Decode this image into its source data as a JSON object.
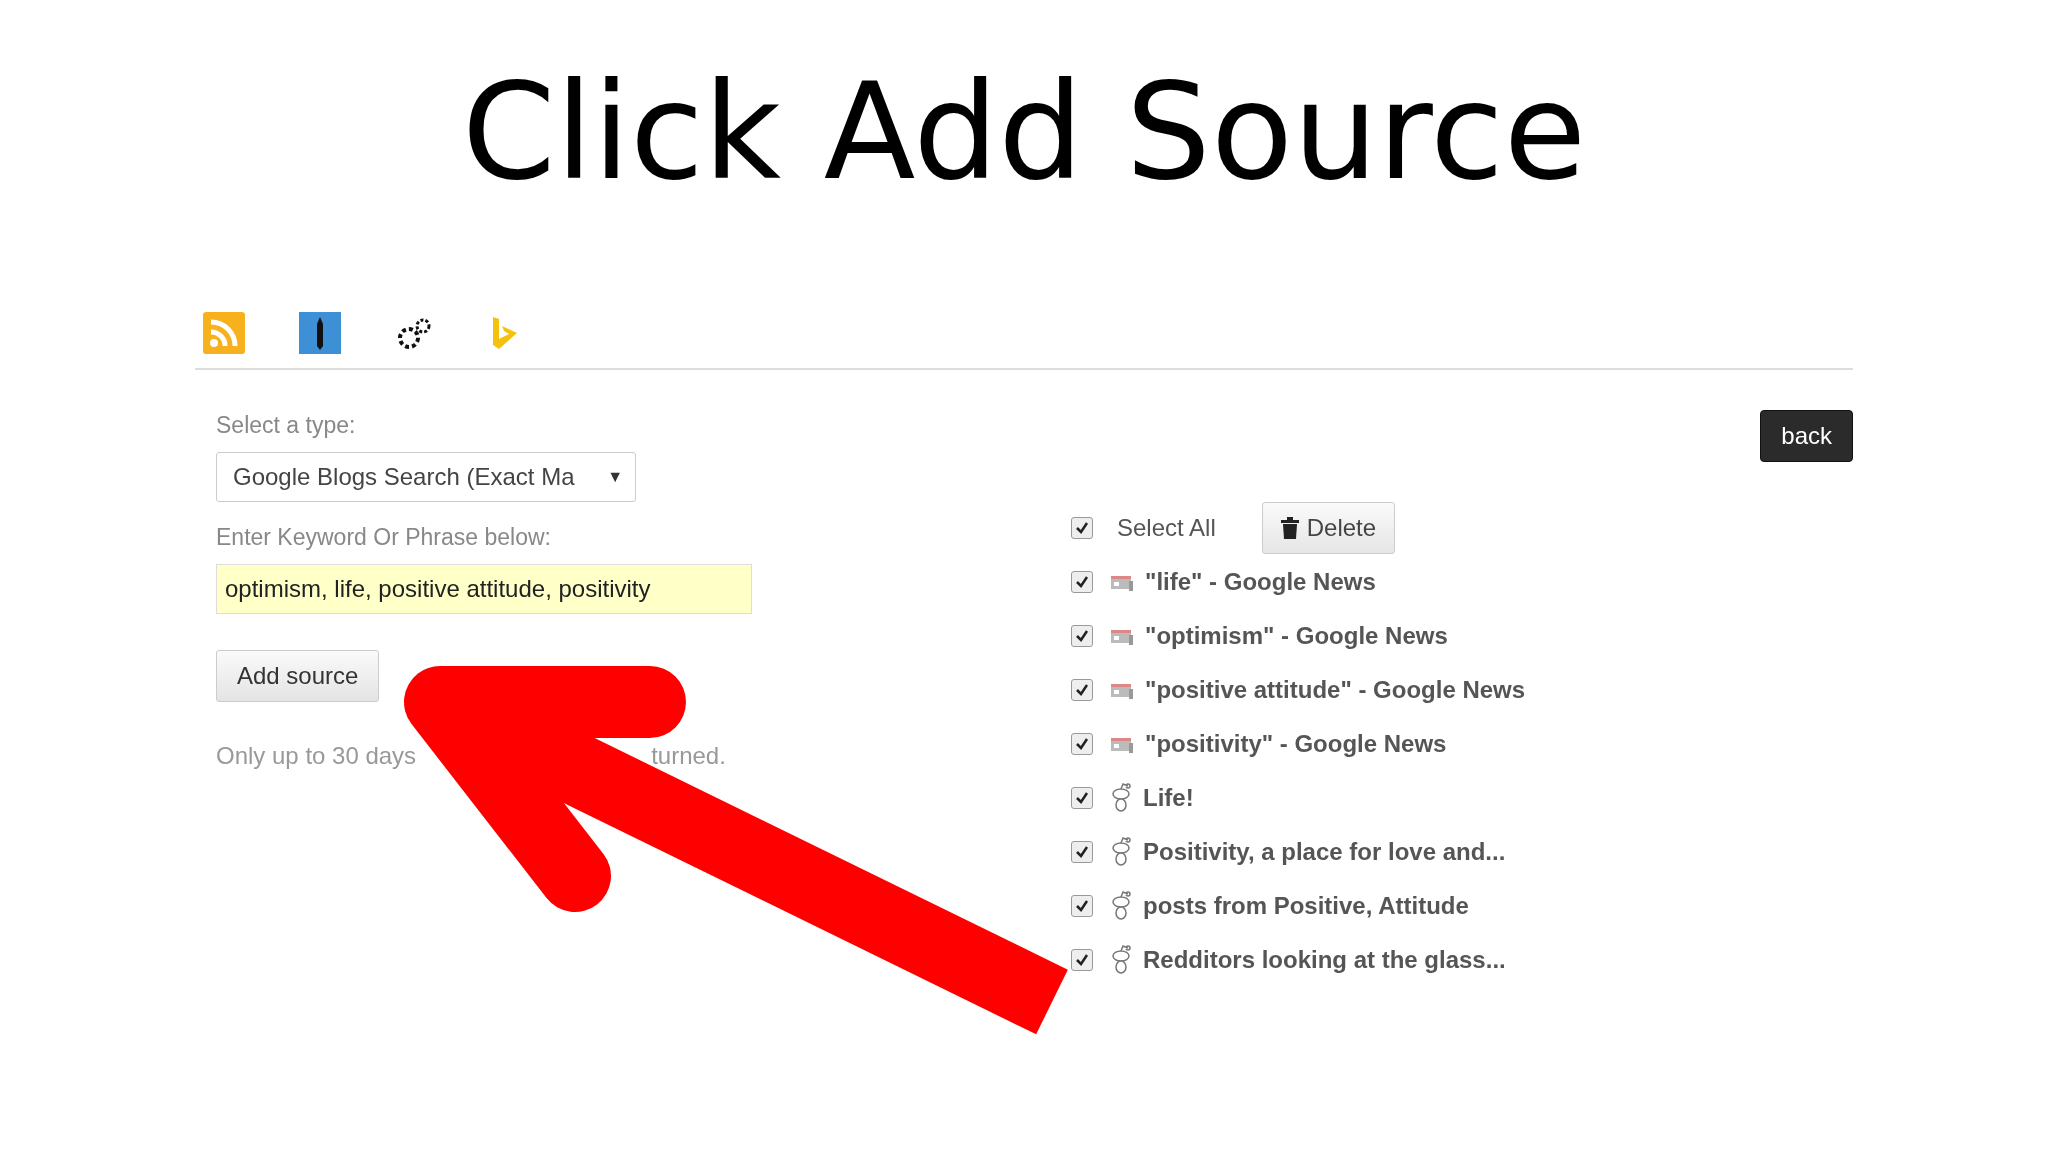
{
  "slide_title": "Click Add Source",
  "toolbar": {
    "icons": [
      {
        "kind": "rss"
      },
      {
        "kind": "pencil"
      },
      {
        "kind": "gears"
      },
      {
        "kind": "logo"
      }
    ]
  },
  "form": {
    "type_label": "Select a type:",
    "type_select": {
      "value": "Google Blogs Search (Exact Ma",
      "caret": "▼"
    },
    "keyword_label": "Enter Keyword Or Phrase below:",
    "keyword_input": {
      "value": "optimism, life, positive attitude, positivity"
    },
    "add_button": "Add source",
    "note_parts": [
      "Only up to 30 days",
      "turned."
    ]
  },
  "back_button": "back",
  "source_list": {
    "select_all": {
      "label": "Select All",
      "checked": true
    },
    "delete_button": "Delete",
    "items": [
      {
        "kind": "news",
        "label": "\"life\" - Google News",
        "checked": true
      },
      {
        "kind": "news",
        "label": "\"optimism\" - Google News",
        "checked": true
      },
      {
        "kind": "news",
        "label": "\"positive attitude\" - Google News",
        "checked": true
      },
      {
        "kind": "news",
        "label": "\"positivity\" - Google News",
        "checked": true
      },
      {
        "kind": "forum",
        "label": "Life!",
        "checked": true
      },
      {
        "kind": "forum",
        "label": "Positivity, a place for love and...",
        "checked": true
      },
      {
        "kind": "forum",
        "label": "posts from Positive, Attitude",
        "checked": true
      },
      {
        "kind": "forum",
        "label": "Redditors looking at the glass...",
        "checked": true
      }
    ]
  },
  "overlay": {
    "kind": "arrow"
  }
}
